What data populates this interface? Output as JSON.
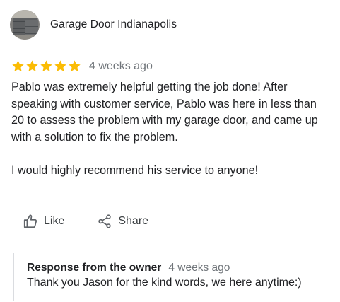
{
  "review": {
    "author": "Garage Door Indianapolis",
    "rating": 5,
    "rating_max": 5,
    "time": "4 weeks ago",
    "paragraphs": [
      "Pablo was extremely helpful getting the job done! After speaking with customer service, Pablo was here in less than 20 to assess the problem with my garage door, and came up with a solution to fix the problem.",
      "I would highly recommend his service to anyone!"
    ],
    "star_color": "#fbbc04"
  },
  "actions": {
    "like_label": "Like",
    "like_icon": "thumbs-up-icon",
    "share_label": "Share",
    "share_icon": "share-icon"
  },
  "owner_response": {
    "title": "Response from the owner",
    "time": "4 weeks ago",
    "text": "Thank you Jason for the kind words, we here anytime:)"
  }
}
